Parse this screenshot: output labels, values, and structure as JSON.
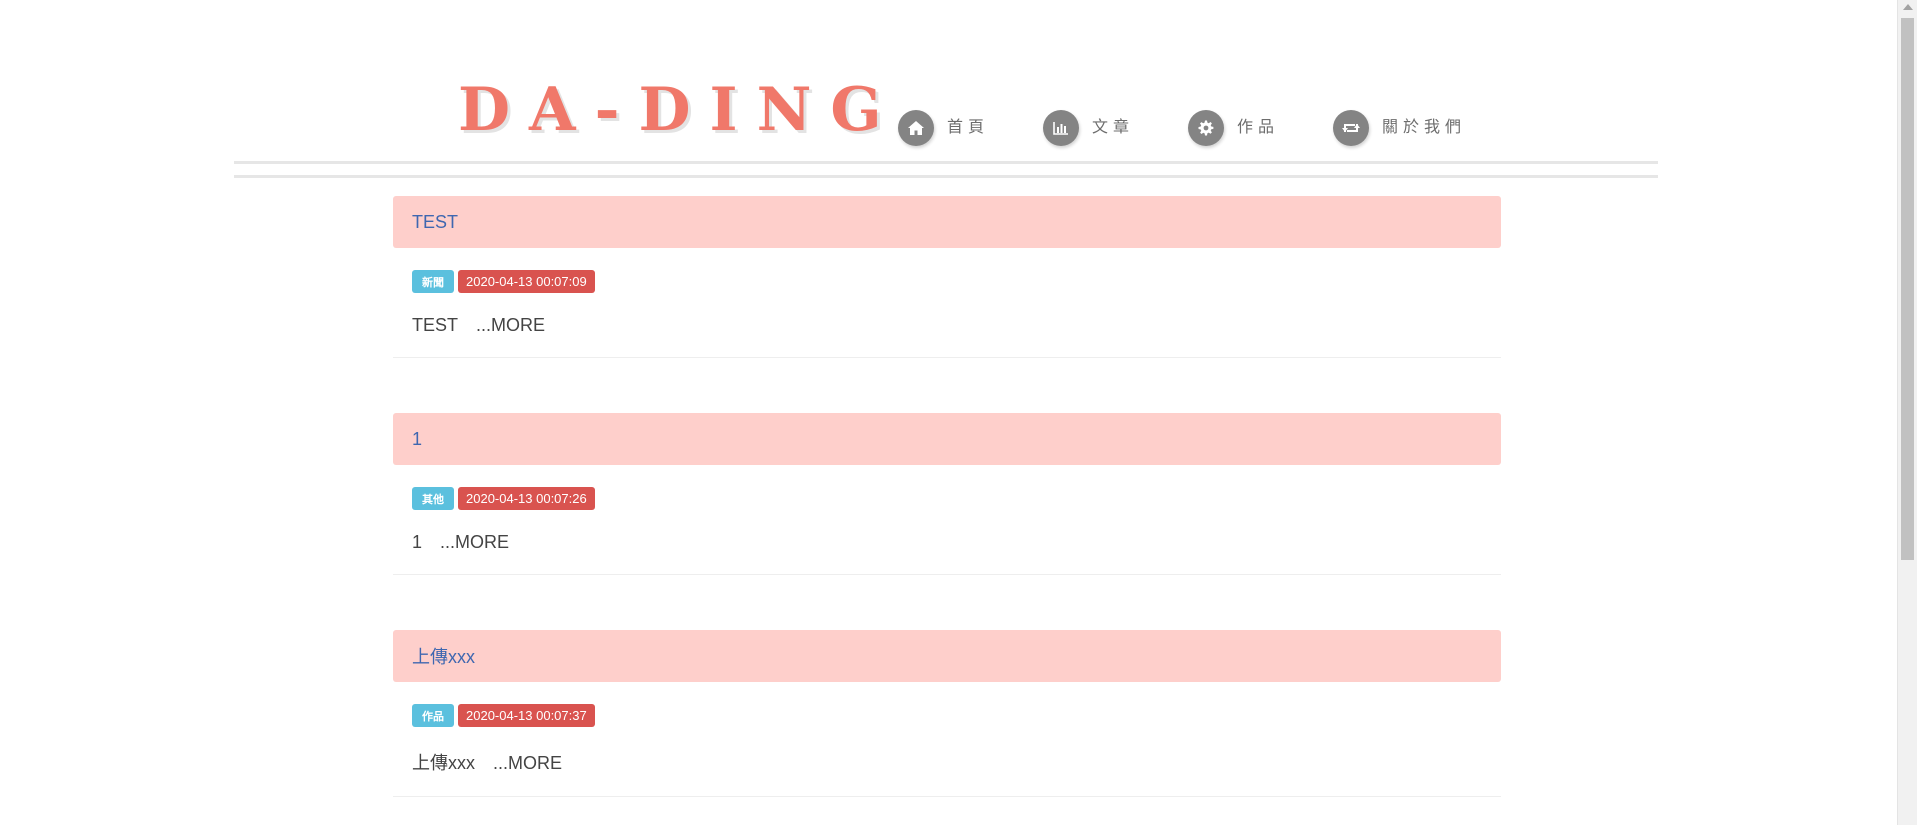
{
  "brand": "DA-DING",
  "nav": [
    {
      "label": "首頁",
      "icon": "home-icon"
    },
    {
      "label": "文章",
      "icon": "bar-chart-icon"
    },
    {
      "label": "作品",
      "icon": "gear-icon"
    },
    {
      "label": "關於我們",
      "icon": "retweet-icon"
    }
  ],
  "posts": [
    {
      "title": "TEST",
      "category": "新聞",
      "date": "2020-04-13 00:07:09",
      "excerpt": "TEST",
      "more": "...MORE"
    },
    {
      "title": "1",
      "category": "其他",
      "date": "2020-04-13 00:07:26",
      "excerpt": "1",
      "more": "...MORE"
    },
    {
      "title": "上傳xxx",
      "category": "作品",
      "date": "2020-04-13 00:07:37",
      "excerpt": "上傳xxx",
      "more": "...MORE"
    }
  ],
  "colors": {
    "brand": "#f0786a",
    "post_header": "#fecfcb",
    "title_link": "#3f67b0",
    "category_badge": "#5bc0de",
    "date_badge": "#d9534f",
    "nav_icon_bg": "#848484"
  }
}
